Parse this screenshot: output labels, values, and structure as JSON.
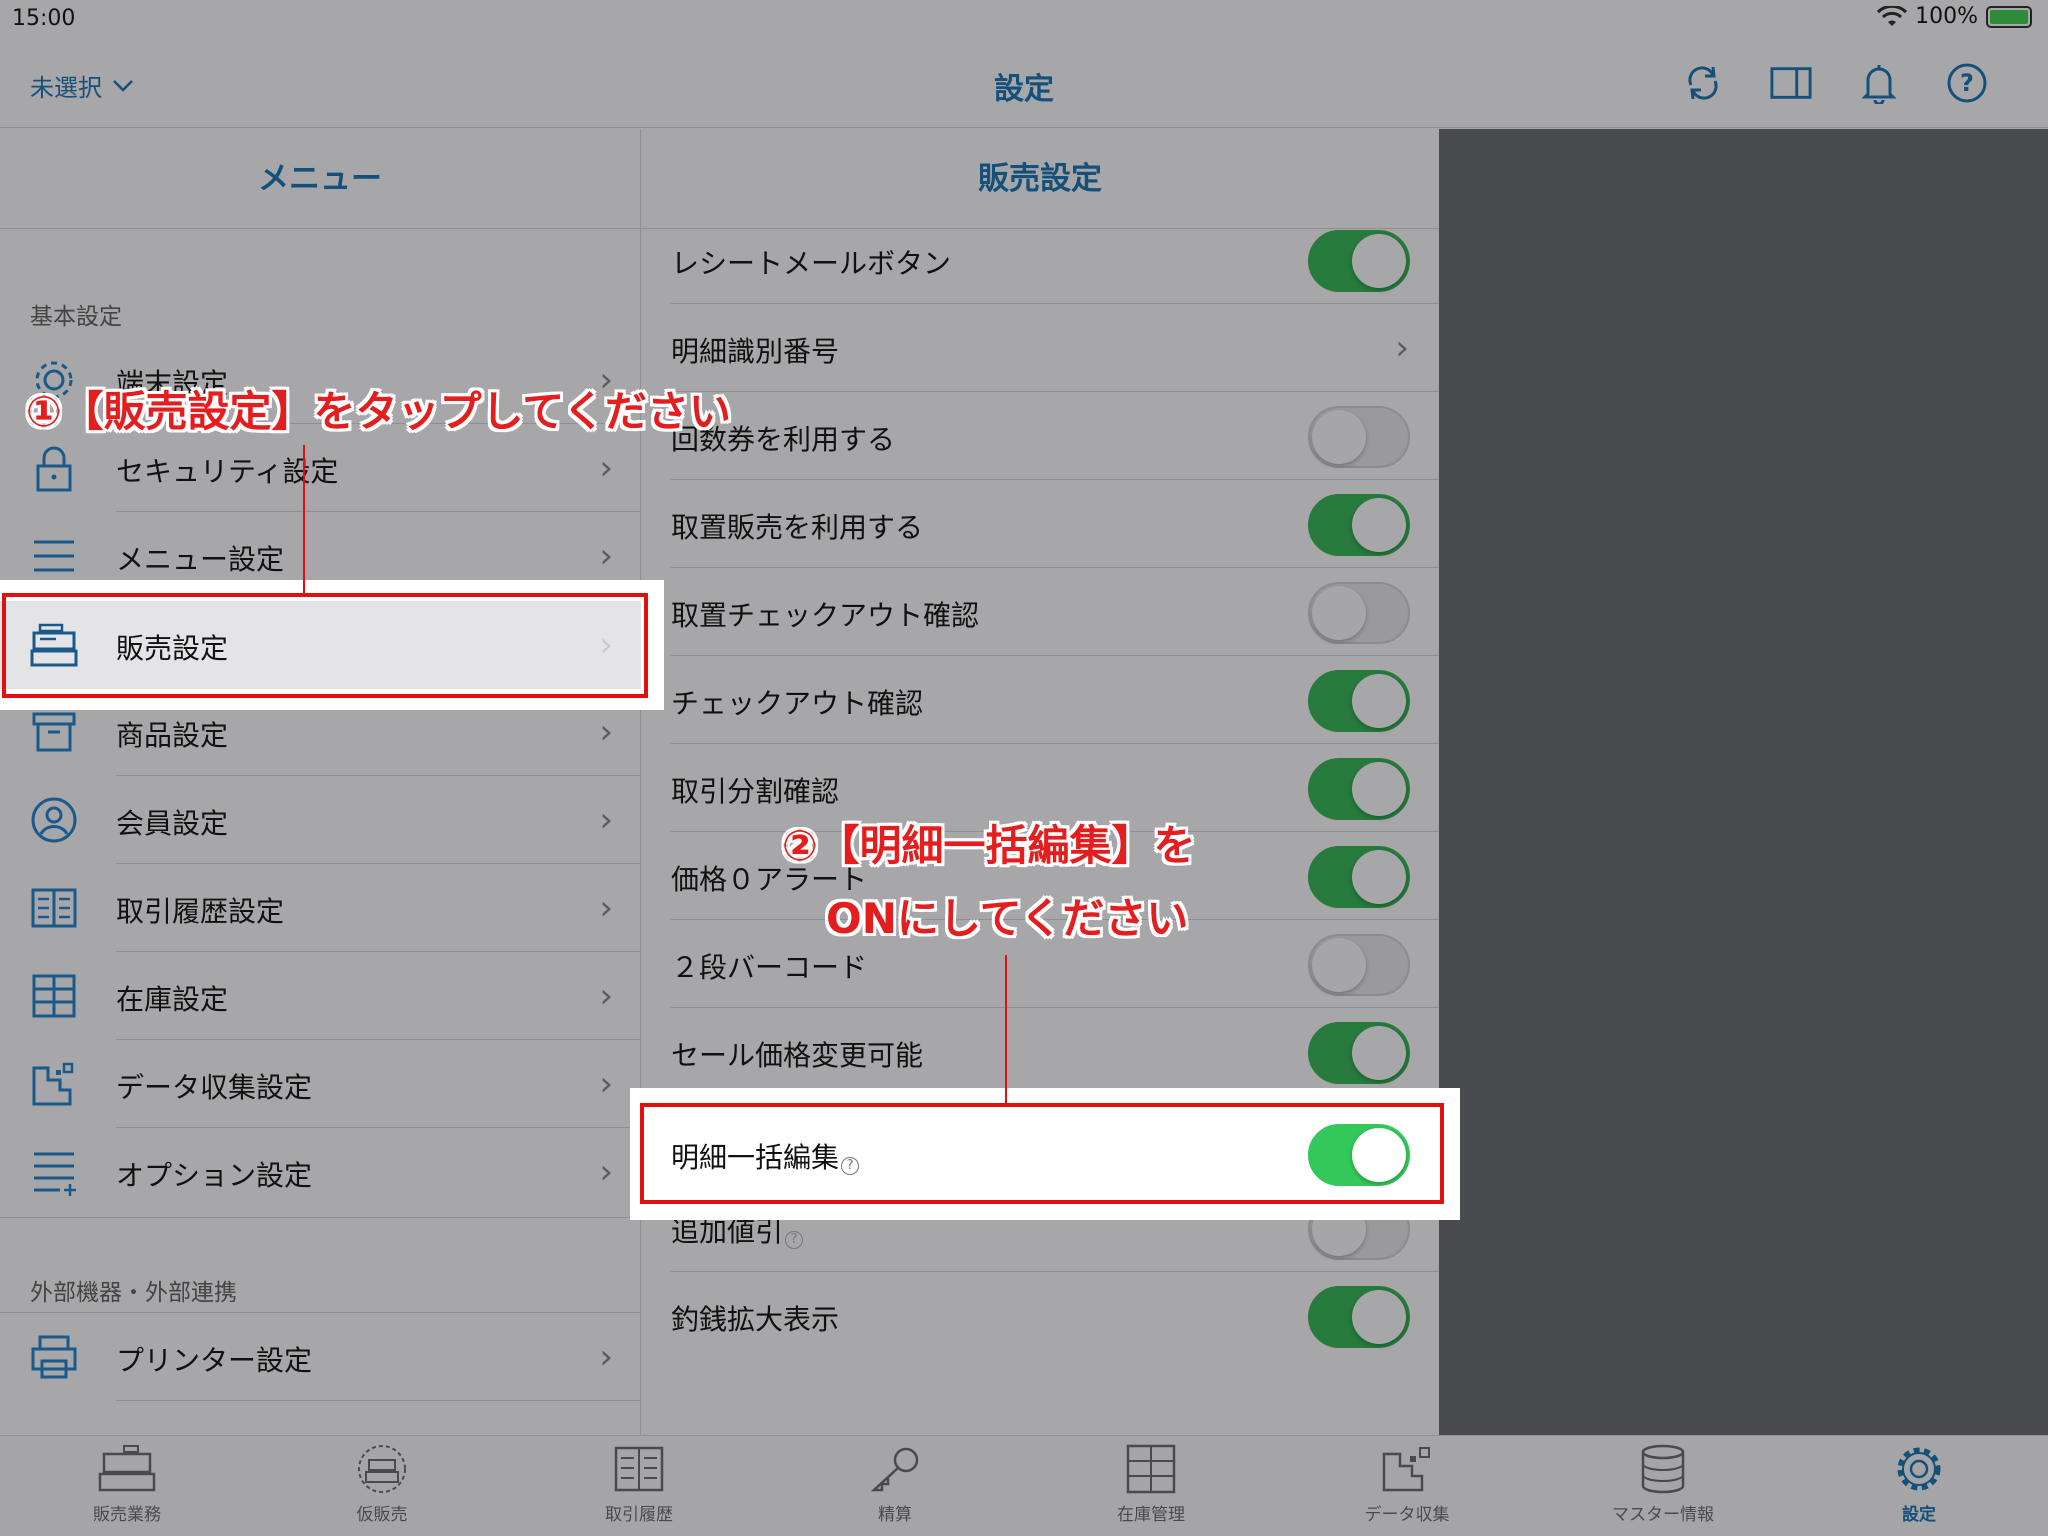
{
  "status_bar": {
    "time": "15:00",
    "battery": "100%"
  },
  "nav": {
    "store_selector": "未選択",
    "title": "設定"
  },
  "menu": {
    "header": "メニュー",
    "section_basic": "基本設定",
    "items": [
      {
        "label": "端末設定"
      },
      {
        "label": "セキュリティ設定"
      },
      {
        "label": "メニュー設定"
      },
      {
        "label": "販売設定"
      },
      {
        "label": "商品設定"
      },
      {
        "label": "会員設定"
      },
      {
        "label": "取引履歴設定"
      },
      {
        "label": "在庫設定"
      },
      {
        "label": "データ収集設定"
      },
      {
        "label": "オプション設定"
      }
    ],
    "section_external": "外部機器・外部連携",
    "external_items": [
      {
        "label": "プリンター設定"
      }
    ]
  },
  "detail": {
    "header": "販売設定",
    "rows": [
      {
        "label": "レシートメールボタン",
        "type": "toggle",
        "on": true
      },
      {
        "label": "明細識別番号",
        "type": "link"
      },
      {
        "label": "回数券を利用する",
        "type": "toggle",
        "on": false
      },
      {
        "label": "取置販売を利用する",
        "type": "toggle",
        "on": true
      },
      {
        "label": "取置チェックアウト確認",
        "type": "toggle",
        "on": false
      },
      {
        "label": "チェックアウト確認",
        "type": "toggle",
        "on": true
      },
      {
        "label": "取引分割確認",
        "type": "toggle",
        "on": true
      },
      {
        "label": "価格０アラート",
        "type": "toggle",
        "on": true
      },
      {
        "label": "２段バーコード",
        "type": "toggle",
        "on": false
      },
      {
        "label": "セール価格変更可能",
        "type": "toggle",
        "on": true
      },
      {
        "label": "明細一括編集",
        "type": "toggle",
        "on": true
      },
      {
        "label": "追加値引",
        "type": "toggle",
        "on": false
      },
      {
        "label": "釣銭拡大表示",
        "type": "toggle",
        "on": true
      }
    ]
  },
  "annotations": {
    "step1": "①【販売設定】をタップしてください",
    "step2_line1": "②【明細一括編集】を",
    "step2_line2": "ONにしてください"
  },
  "tabs": [
    {
      "label": "販売業務",
      "icon": "register-icon"
    },
    {
      "label": "仮販売",
      "icon": "temp-sale-icon"
    },
    {
      "label": "取引履歴",
      "icon": "history-icon"
    },
    {
      "label": "精算",
      "icon": "key-icon"
    },
    {
      "label": "在庫管理",
      "icon": "inventory-icon"
    },
    {
      "label": "データ収集",
      "icon": "data-collect-icon"
    },
    {
      "label": "マスター情報",
      "icon": "database-icon"
    },
    {
      "label": "設定",
      "icon": "gear-icon",
      "active": true
    }
  ],
  "colors": {
    "accent": "#14507a",
    "toggle_on": "#34c759",
    "annotation": "#e41e1e",
    "dark_pane": "#4a4b4f"
  }
}
